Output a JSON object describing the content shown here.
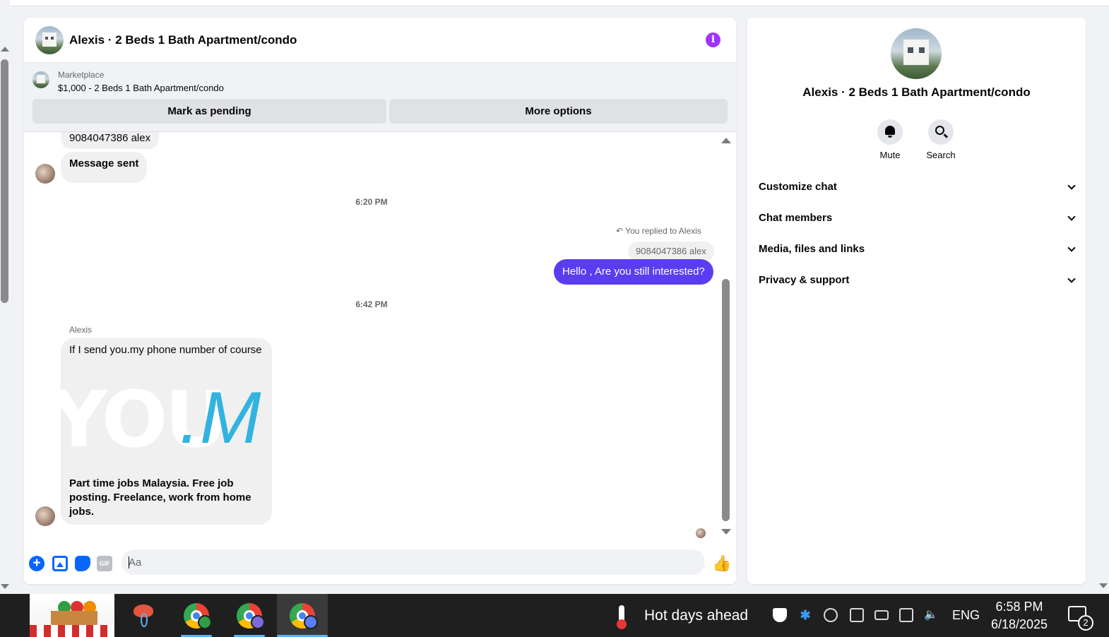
{
  "chat": {
    "title": "Alexis · 2 Beds 1 Bath Apartment/condo",
    "info_icon": "info-icon",
    "marketplace": {
      "label": "Marketplace",
      "listing": "$1,000 - 2 Beds 1 Bath Apartment/condo",
      "mark_pending_label": "Mark as pending",
      "more_options_label": "More options"
    },
    "messages": {
      "received_1": "9084047386 alex",
      "received_2": "Message sent",
      "time_1": "6:20 PM",
      "replied_label": "You replied to Alexis",
      "quoted": "9084047386 alex",
      "sent_1": "Hello , Are you still interested?",
      "time_2": "6:42 PM",
      "sender_name": "Alexis",
      "received_3": "If I send you.my phone number of course",
      "preview_image_text_1": "YOU",
      "preview_image_text_2": ".M",
      "preview_desc": "Part time jobs Malaysia. Free job posting. Freelance, work from home jobs."
    },
    "composer": {
      "placeholder": "Aa",
      "gif_label": "GIF"
    }
  },
  "sidebar": {
    "title": "Alexis · 2 Beds 1 Bath Apartment/condo",
    "actions": {
      "mute_label": "Mute",
      "search_label": "Search"
    },
    "sections": [
      {
        "label": "Customize chat"
      },
      {
        "label": "Chat members"
      },
      {
        "label": "Media, files and links"
      },
      {
        "label": "Privacy & support"
      }
    ]
  },
  "taskbar": {
    "weather_text": "Hot days ahead",
    "language": "ENG",
    "time": "6:58 PM",
    "date": "6/18/2025",
    "notification_count": "2",
    "accent_color": "#5fb2f2"
  },
  "colors": {
    "messenger_purple": "#5b3df0",
    "info_purple": "#a033ff",
    "link_blue": "#0866ff"
  }
}
